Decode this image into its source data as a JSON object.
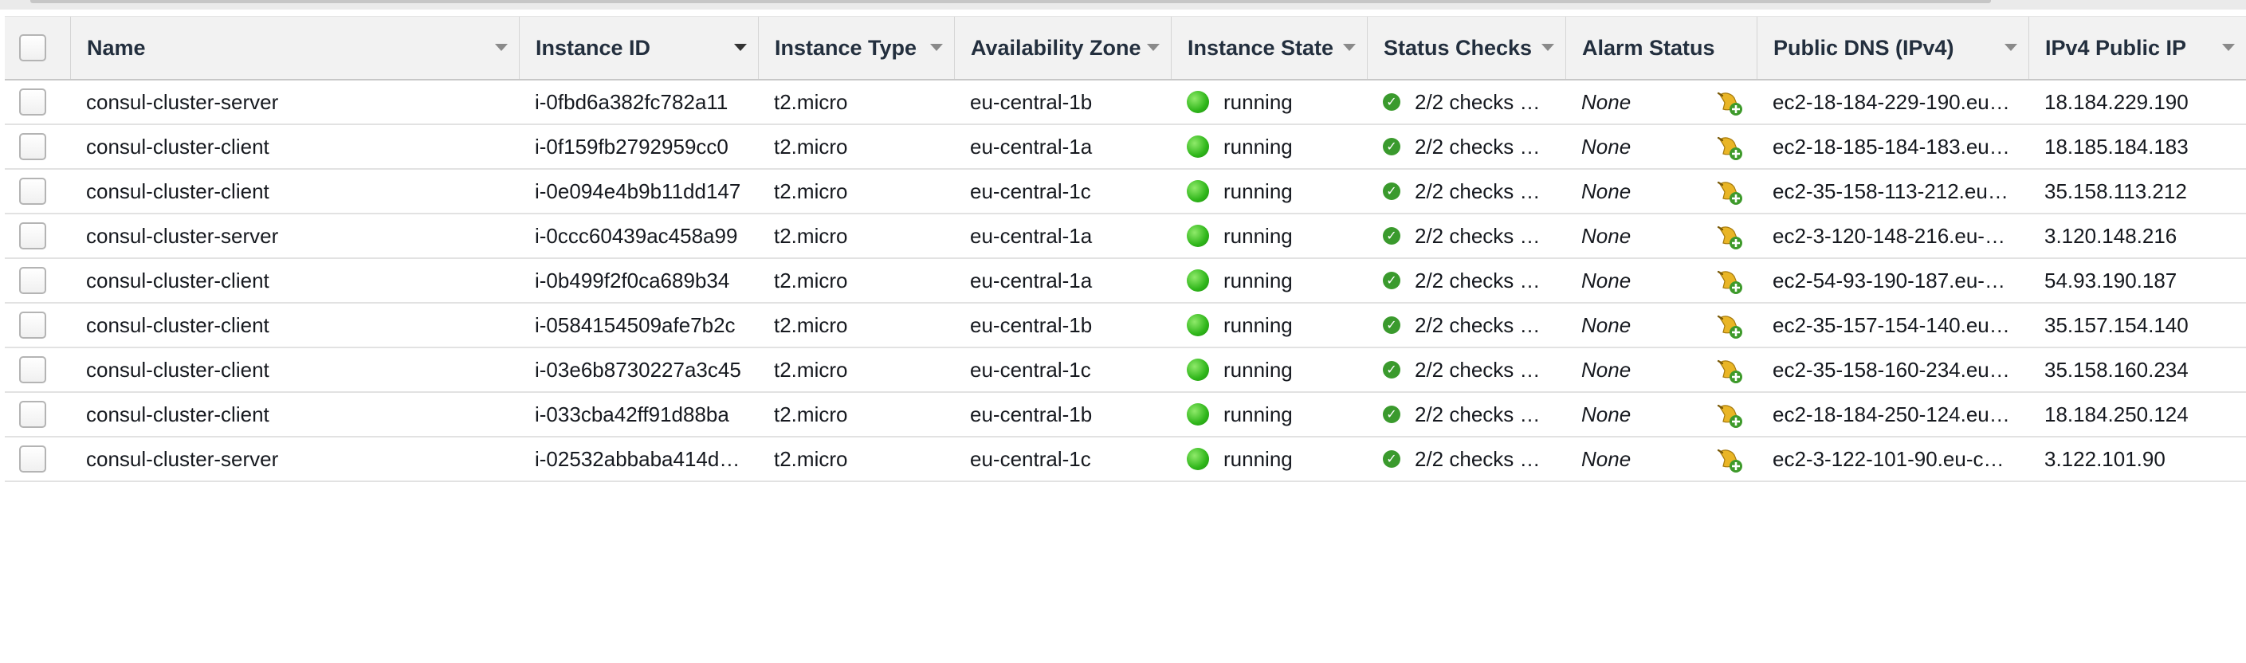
{
  "columns": {
    "name": "Name",
    "instance_id": "Instance ID",
    "instance_type": "Instance Type",
    "availability_zone": "Availability Zone",
    "instance_state": "Instance State",
    "status_checks": "Status Checks",
    "alarm_status": "Alarm Status",
    "public_dns": "Public DNS (IPv4)",
    "public_ip": "IPv4 Public IP"
  },
  "rows": [
    {
      "name": "consul-cluster-server",
      "id": "i-0fbd6a382fc782a11",
      "type": "t2.micro",
      "az": "eu-central-1b",
      "state": "running",
      "checks": "2/2 checks …",
      "alarm": "None",
      "dns": "ec2-18-184-229-190.eu…",
      "ip": "18.184.229.190"
    },
    {
      "name": "consul-cluster-client",
      "id": "i-0f159fb2792959cc0",
      "type": "t2.micro",
      "az": "eu-central-1a",
      "state": "running",
      "checks": "2/2 checks …",
      "alarm": "None",
      "dns": "ec2-18-185-184-183.eu…",
      "ip": "18.185.184.183"
    },
    {
      "name": "consul-cluster-client",
      "id": "i-0e094e4b9b11dd147",
      "type": "t2.micro",
      "az": "eu-central-1c",
      "state": "running",
      "checks": "2/2 checks …",
      "alarm": "None",
      "dns": "ec2-35-158-113-212.eu…",
      "ip": "35.158.113.212"
    },
    {
      "name": "consul-cluster-server",
      "id": "i-0ccc60439ac458a99",
      "type": "t2.micro",
      "az": "eu-central-1a",
      "state": "running",
      "checks": "2/2 checks …",
      "alarm": "None",
      "dns": "ec2-3-120-148-216.eu-…",
      "ip": "3.120.148.216"
    },
    {
      "name": "consul-cluster-client",
      "id": "i-0b499f2f0ca689b34",
      "type": "t2.micro",
      "az": "eu-central-1a",
      "state": "running",
      "checks": "2/2 checks …",
      "alarm": "None",
      "dns": "ec2-54-93-190-187.eu-…",
      "ip": "54.93.190.187"
    },
    {
      "name": "consul-cluster-client",
      "id": "i-0584154509afe7b2c",
      "type": "t2.micro",
      "az": "eu-central-1b",
      "state": "running",
      "checks": "2/2 checks …",
      "alarm": "None",
      "dns": "ec2-35-157-154-140.eu…",
      "ip": "35.157.154.140"
    },
    {
      "name": "consul-cluster-client",
      "id": "i-03e6b8730227a3c45",
      "type": "t2.micro",
      "az": "eu-central-1c",
      "state": "running",
      "checks": "2/2 checks …",
      "alarm": "None",
      "dns": "ec2-35-158-160-234.eu…",
      "ip": "35.158.160.234"
    },
    {
      "name": "consul-cluster-client",
      "id": "i-033cba42ff91d88ba",
      "type": "t2.micro",
      "az": "eu-central-1b",
      "state": "running",
      "checks": "2/2 checks …",
      "alarm": "None",
      "dns": "ec2-18-184-250-124.eu…",
      "ip": "18.184.250.124"
    },
    {
      "name": "consul-cluster-server",
      "id": "i-02532abbaba414d…",
      "type": "t2.micro",
      "az": "eu-central-1c",
      "state": "running",
      "checks": "2/2 checks …",
      "alarm": "None",
      "dns": "ec2-3-122-101-90.eu-c…",
      "ip": "3.122.101.90"
    }
  ],
  "colors": {
    "header_bg": "#f2f2f2",
    "running": "#2fb61a",
    "check_ok": "#3a9a2d"
  },
  "icons": {
    "state": "green-dot-icon",
    "checks": "check-circle-icon",
    "alarm": "create-alarm-bell-icon",
    "sort": "sort-arrow-icon"
  }
}
